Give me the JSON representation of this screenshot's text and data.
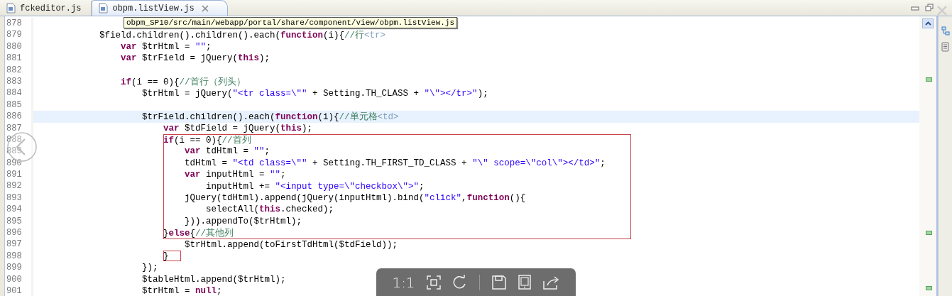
{
  "tabs": [
    {
      "label": "fckeditor.js",
      "selected": false,
      "closable": false
    },
    {
      "label": "obpm.listView.js",
      "selected": true,
      "closable": true
    }
  ],
  "tooltip": "obpm_SP10/src/main/webapp/portal/share/component/view/obpm.listView.js",
  "lines": [
    {
      "number": "878",
      "current": false
    },
    {
      "number": "879",
      "current": false,
      "segments": [
        {
          "kind": "plain",
          "text": "            $field.children().children().each("
        },
        {
          "kind": "keyword",
          "text": "function"
        },
        {
          "kind": "plain",
          "text": "(i){"
        },
        {
          "kind": "comment",
          "text": "//行"
        },
        {
          "kind": "tag",
          "text": "<tr>"
        }
      ]
    },
    {
      "number": "880",
      "current": false,
      "segments": [
        {
          "kind": "keyword",
          "text": "                var"
        },
        {
          "kind": "plain",
          "text": " $trHtml = "
        },
        {
          "kind": "string",
          "text": "\"\""
        },
        {
          "kind": "plain",
          "text": ";"
        }
      ]
    },
    {
      "number": "881",
      "current": false,
      "segments": [
        {
          "kind": "keyword",
          "text": "                var"
        },
        {
          "kind": "plain",
          "text": " $trField = jQuery("
        },
        {
          "kind": "keyword",
          "text": "this"
        },
        {
          "kind": "plain",
          "text": ");"
        }
      ]
    },
    {
      "number": "882",
      "current": false
    },
    {
      "number": "883",
      "current": false,
      "segments": [
        {
          "kind": "keyword",
          "text": "                if"
        },
        {
          "kind": "plain",
          "text": "(i == 0){"
        },
        {
          "kind": "comment",
          "text": "//首行（列头）"
        }
      ]
    },
    {
      "number": "884",
      "current": false,
      "segments": [
        {
          "kind": "plain",
          "text": "                    $trHtml = jQuery("
        },
        {
          "kind": "string",
          "text": "\"<tr class=\\\"\""
        },
        {
          "kind": "plain",
          "text": " + Setting.TH_CLASS + "
        },
        {
          "kind": "string",
          "text": "\"\\\"></tr>\""
        },
        {
          "kind": "plain",
          "text": ");"
        }
      ]
    },
    {
      "number": "885",
      "current": false
    },
    {
      "number": "886",
      "current": true,
      "segments": [
        {
          "kind": "plain",
          "text": "                    $trField.children().each("
        },
        {
          "kind": "keyword",
          "text": "function"
        },
        {
          "kind": "plain",
          "text": "(i){"
        },
        {
          "kind": "comment",
          "text": "//单元格"
        },
        {
          "kind": "tag",
          "text": "<td>"
        }
      ]
    },
    {
      "number": "887",
      "current": false,
      "segments": [
        {
          "kind": "keyword",
          "text": "                        var"
        },
        {
          "kind": "plain",
          "text": " $tdField = jQuery("
        },
        {
          "kind": "keyword",
          "text": "this"
        },
        {
          "kind": "plain",
          "text": ");"
        }
      ]
    },
    {
      "number": "888",
      "current": false,
      "segments": [
        {
          "kind": "keyword",
          "text": "                        if"
        },
        {
          "kind": "plain",
          "text": "(i == 0){"
        },
        {
          "kind": "comment",
          "text": "//首列"
        }
      ]
    },
    {
      "number": "889",
      "current": false,
      "segments": [
        {
          "kind": "keyword",
          "text": "                            var"
        },
        {
          "kind": "plain",
          "text": " tdHtml = "
        },
        {
          "kind": "string",
          "text": "\"\""
        },
        {
          "kind": "plain",
          "text": ";"
        }
      ]
    },
    {
      "number": "890",
      "current": false,
      "segments": [
        {
          "kind": "plain",
          "text": "                            tdHtml = "
        },
        {
          "kind": "string",
          "text": "\"<td class=\\\"\""
        },
        {
          "kind": "plain",
          "text": " + Setting.TH_FIRST_TD_CLASS + "
        },
        {
          "kind": "string",
          "text": "\"\\\" scope=\\\"col\\\"></td>\""
        },
        {
          "kind": "plain",
          "text": ";"
        }
      ]
    },
    {
      "number": "891",
      "current": false,
      "segments": [
        {
          "kind": "keyword",
          "text": "                            var"
        },
        {
          "kind": "plain",
          "text": " inputHtml = "
        },
        {
          "kind": "string",
          "text": "\"\""
        },
        {
          "kind": "plain",
          "text": ";"
        }
      ]
    },
    {
      "number": "892",
      "current": false,
      "segments": [
        {
          "kind": "plain",
          "text": "                                inputHtml += "
        },
        {
          "kind": "string",
          "text": "\"<input type=\\\"checkbox\\\">\""
        },
        {
          "kind": "plain",
          "text": ";"
        }
      ]
    },
    {
      "number": "893",
      "current": false,
      "segments": [
        {
          "kind": "plain",
          "text": "                            jQuery(tdHtml).append(jQuery(inputHtml).bind("
        },
        {
          "kind": "string",
          "text": "\"click\""
        },
        {
          "kind": "plain",
          "text": ","
        },
        {
          "kind": "keyword",
          "text": "function"
        },
        {
          "kind": "plain",
          "text": "(){"
        }
      ]
    },
    {
      "number": "894",
      "current": false,
      "segments": [
        {
          "kind": "plain",
          "text": "                                selectAll("
        },
        {
          "kind": "keyword",
          "text": "this"
        },
        {
          "kind": "plain",
          "text": ".checked);"
        }
      ]
    },
    {
      "number": "895",
      "current": false,
      "segments": [
        {
          "kind": "plain",
          "text": "                            })).appendTo($trHtml);"
        }
      ]
    },
    {
      "number": "896",
      "current": false,
      "segments": [
        {
          "kind": "plain",
          "text": "                        }"
        },
        {
          "kind": "keyword",
          "text": "else"
        },
        {
          "kind": "plain",
          "text": "{"
        },
        {
          "kind": "comment",
          "text": "//其他列"
        }
      ]
    },
    {
      "number": "897",
      "current": false,
      "segments": [
        {
          "kind": "plain",
          "text": "                            $trHtml.append(toFirstTdHtml($tdField));"
        }
      ]
    },
    {
      "number": "898",
      "current": false,
      "segments": [
        {
          "kind": "plain",
          "text": "                        }"
        }
      ]
    },
    {
      "number": "899",
      "current": false,
      "segments": [
        {
          "kind": "plain",
          "text": "                    });"
        }
      ]
    },
    {
      "number": "900",
      "current": false,
      "segments": [
        {
          "kind": "plain",
          "text": "                    $tableHtml.append($trHtml);"
        }
      ]
    },
    {
      "number": "901",
      "current": false,
      "segments": [
        {
          "kind": "plain",
          "text": "                    $trHtml = "
        },
        {
          "kind": "keyword",
          "text": "null"
        },
        {
          "kind": "plain",
          "text": ";"
        }
      ]
    }
  ],
  "viewer_toolbar": {
    "zoom_label": "1:1"
  }
}
